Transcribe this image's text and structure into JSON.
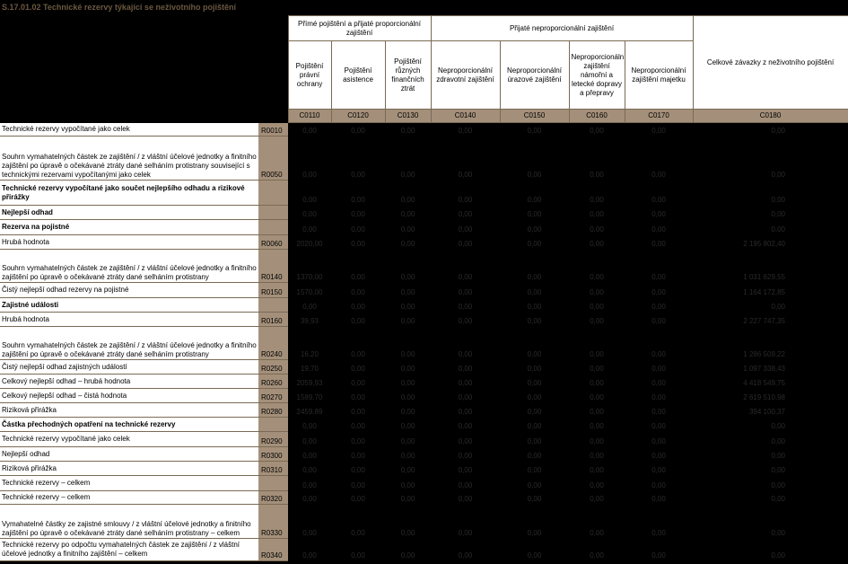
{
  "title": "S.17.01.02 Technické rezervy týkající se neživotního pojištění",
  "header": {
    "group1": "Přímé pojištění a přijaté proporcionální zajištění",
    "group2": "Přijaté neproporcionální zajištění",
    "total": "Celkové závazky z neživotního pojištění",
    "columns": [
      "Pojištění právní ochrany",
      "Pojištění asistence",
      "Pojištění různých finančních ztrát",
      "Neproporcionální zdravotní zajištění",
      "Neproporcionální úrazové zajištění",
      "Neproporcionální zajištění námořní a letecké dopravy a přepravy",
      "Neproporcionální zajištění majetku"
    ],
    "codes": [
      "C0110",
      "C0120",
      "C0130",
      "C0140",
      "C0150",
      "C0160",
      "C0170",
      "C0180"
    ]
  },
  "rows": [
    {
      "label": "Technické rezervy vypočítané jako celek",
      "code": "R0010",
      "values": [
        "0,00",
        "0,00",
        "0,00",
        "0,00",
        "0,00",
        "0,00",
        "0,00",
        "0,00"
      ]
    },
    {
      "label": "Souhrn vymahatelných částek ze zajištění / z vláštní účelové jednotky a finitního zajištění po úpravě o očekávané ztráty dané selháním protistrany související s technickými rezervami vypočítanými jako celek",
      "code": "R0050",
      "values": [
        "0,00",
        "0,00",
        "0,00",
        "0,00",
        "0,00",
        "0,00",
        "0,00",
        "0,00"
      ]
    },
    {
      "label": "Technické rezervy vypočítané jako součet nejlepšího odhadu a rizikové přirážky",
      "code": "",
      "bold": true,
      "values": [
        "0,00",
        "0,00",
        "0,00",
        "0,00",
        "0,00",
        "0,00",
        "0,00",
        "0,00"
      ]
    },
    {
      "label": "Nejlepší odhad",
      "code": "",
      "bold": true,
      "values": [
        "0,00",
        "0,00",
        "0,00",
        "0,00",
        "0,00",
        "0,00",
        "0,00",
        "0,00"
      ]
    },
    {
      "label": "Rezerva na pojistné",
      "code": "",
      "bold": true,
      "values": [
        "0,00",
        "0,00",
        "0,00",
        "0,00",
        "0,00",
        "0,00",
        "0,00",
        "0,00"
      ]
    },
    {
      "label": "Hrubá hodnota",
      "code": "R0060",
      "values": [
        "2020,00",
        "0,00",
        "0,00",
        "0,00",
        "0,00",
        "0,00",
        "0,00",
        "2 195 802,40"
      ]
    },
    {
      "label": "Souhrn vymahatelných částek ze zajištění / z vláštní účelové jednotky a finitního zajištění po úpravě o očekávané ztráty dané selháním protistrany",
      "code": "R0140",
      "values": [
        "1370,00",
        "0,00",
        "0,00",
        "0,00",
        "0,00",
        "0,00",
        "0,00",
        "1 031 629,55"
      ]
    },
    {
      "label": "Čistý nejlepší odhad rezervy na pojistné",
      "code": "R0150",
      "values": [
        "1570,00",
        "0,00",
        "0,00",
        "0,00",
        "0,00",
        "0,00",
        "0,00",
        "1 164 172,85"
      ]
    },
    {
      "label": "Zajistné události",
      "code": "",
      "bold": true,
      "values": [
        "0,00",
        "0,00",
        "0,00",
        "0,00",
        "0,00",
        "0,00",
        "0,00",
        "0,00"
      ]
    },
    {
      "label": "Hrubá hodnota",
      "code": "R0160",
      "values": [
        "39,93",
        "0,00",
        "0,00",
        "0,00",
        "0,00",
        "0,00",
        "0,00",
        "2 227 747,35"
      ]
    },
    {
      "label": "Souhrn vymahatelných částek ze zajištění / z vláštní účelové jednotky a finitního zajištění po úpravě o očekávané ztráty dané selháním protistrany",
      "code": "R0240",
      "values": [
        "16,20",
        "0,00",
        "0,00",
        "0,00",
        "0,00",
        "0,00",
        "0,00",
        "1 286 509,22"
      ]
    },
    {
      "label": "Čistý nejlepší odhad zajistných událostí",
      "code": "R0250",
      "values": [
        "19,70",
        "0,00",
        "0,00",
        "0,00",
        "0,00",
        "0,00",
        "0,00",
        "1 097 338,43"
      ]
    },
    {
      "label": "Celkový nejlepší odhad – hrubá hodnota",
      "code": "R0260",
      "values": [
        "2059,93",
        "0,00",
        "0,00",
        "0,00",
        "0,00",
        "0,00",
        "0,00",
        "4 418 549,75"
      ]
    },
    {
      "label": "Celkový nejlepší odhad – čistá hodnota",
      "code": "R0270",
      "values": [
        "1589,70",
        "0,00",
        "0,00",
        "0,00",
        "0,00",
        "0,00",
        "0,00",
        "2 619 510,98"
      ]
    },
    {
      "label": "Riziková přirážka",
      "code": "R0280",
      "values": [
        "2459,89",
        "0,00",
        "0,00",
        "0,00",
        "0,00",
        "0,00",
        "0,00",
        "394 100,37"
      ]
    },
    {
      "label": "Částka přechodných opatření na technické rezervy",
      "code": "",
      "bold": true,
      "values": [
        "0,00",
        "0,00",
        "0,00",
        "0,00",
        "0,00",
        "0,00",
        "0,00",
        "0,00"
      ]
    },
    {
      "label": "Technické rezervy vypočítané jako celek",
      "code": "R0290",
      "values": [
        "0,00",
        "0,00",
        "0,00",
        "0,00",
        "0,00",
        "0,00",
        "0,00",
        "0,00"
      ]
    },
    {
      "label": "Nejlepší odhad",
      "code": "R0300",
      "values": [
        "0,00",
        "0,00",
        "0,00",
        "0,00",
        "0,00",
        "0,00",
        "0,00",
        "0,00"
      ]
    },
    {
      "label": "Riziková přirážka",
      "code": "R0310",
      "values": [
        "0,00",
        "0,00",
        "0,00",
        "0,00",
        "0,00",
        "0,00",
        "0,00",
        "0,00"
      ]
    },
    {
      "label": "Technické rezervy – celkem",
      "code": "",
      "values": [
        "0,00",
        "0,00",
        "0,00",
        "0,00",
        "0,00",
        "0,00",
        "0,00",
        "0,00"
      ]
    },
    {
      "label": "Technické rezervy – celkem",
      "code": "R0320",
      "values": [
        "0,00",
        "0,00",
        "0,00",
        "0,00",
        "0,00",
        "0,00",
        "0,00",
        "0,00"
      ]
    },
    {
      "label": "Vymahatelné částky ze zajistné smlouvy / z vláštní účelové jednotky a finitního zajištění po úpravě o očekávané ztráty dané selháním protistrany – celkem",
      "code": "R0330",
      "values": [
        "0,00",
        "0,00",
        "0,00",
        "0,00",
        "0,00",
        "0,00",
        "0,00",
        "0,00"
      ]
    },
    {
      "label": "Technické rezervy po odpočtu vymahatelných částek ze zajištění / z vláštní účelové jednotky a finitního zajištění – celkem",
      "code": "R0340",
      "values": [
        "0,00",
        "0,00",
        "0,00",
        "0,00",
        "0,00",
        "0,00",
        "0,00",
        "0,00"
      ]
    }
  ]
}
